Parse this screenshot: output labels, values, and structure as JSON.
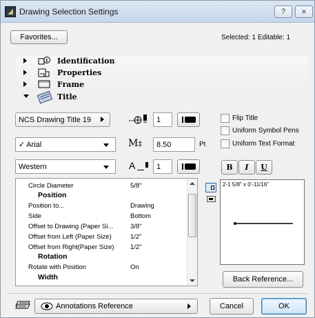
{
  "window": {
    "title": "Drawing Selection Settings",
    "help_label": "?",
    "close_label": "✕"
  },
  "top": {
    "favorites_label": "Favorites...",
    "selection_info": "Selected: 1 Editable: 1"
  },
  "sections": [
    {
      "label": "Identification",
      "expanded": false,
      "icon": "identification-icon"
    },
    {
      "label": "Properties",
      "expanded": false,
      "icon": "properties-icon"
    },
    {
      "label": "Frame",
      "expanded": false,
      "icon": "frame-icon"
    },
    {
      "label": "Title",
      "expanded": true,
      "icon": "title-icon"
    }
  ],
  "title_panel": {
    "title_type": "NCS Drawing Title 19",
    "marker_pen": "1",
    "font_name": "Arial",
    "font_checkmark": "✓",
    "font_size": "8.50",
    "font_size_unit": "Pt",
    "size_icon_text": "M",
    "charset": "Western",
    "text_pen": "1",
    "text_icon_text": "A",
    "flip_title": "Flip Title",
    "uniform_symbol_pens": "Uniform Symbol Pens",
    "uniform_text_format": "Uniform Text Format",
    "bold_label": "B",
    "italic_label": "I",
    "underline_label": "U"
  },
  "params": [
    {
      "key": "Circle Diameter",
      "value": "5/8\"",
      "header": false
    },
    {
      "key": "Position",
      "value": "",
      "header": true
    },
    {
      "key": "Position to...",
      "value": "Drawing",
      "header": false
    },
    {
      "key": "Side",
      "value": "Bottom",
      "header": false
    },
    {
      "key": "Offset to Drawing (Paper Si...",
      "value": "3/8\"",
      "header": false
    },
    {
      "key": "Offset from Left (Paper Size)",
      "value": "1/2\"",
      "header": false
    },
    {
      "key": "Offset from Right(Paper Size)",
      "value": "1/2\"",
      "header": false
    },
    {
      "key": "Rotation",
      "value": "",
      "header": true
    },
    {
      "key": "Rotate with Position",
      "value": "On",
      "header": false
    },
    {
      "key": "Width",
      "value": "",
      "header": true
    }
  ],
  "preview": {
    "dimension_text": "2-1 5/8\" x 0'-11/16\""
  },
  "back_reference_label": "Back Reference...",
  "bottom": {
    "layer_combo": "Annotations Reference",
    "cancel_label": "Cancel",
    "ok_label": "OK"
  },
  "colors": {
    "titlebar": "#c7d6e9",
    "dialog_bg": "#f0f0f0",
    "ok_border": "#3c7fb1"
  }
}
